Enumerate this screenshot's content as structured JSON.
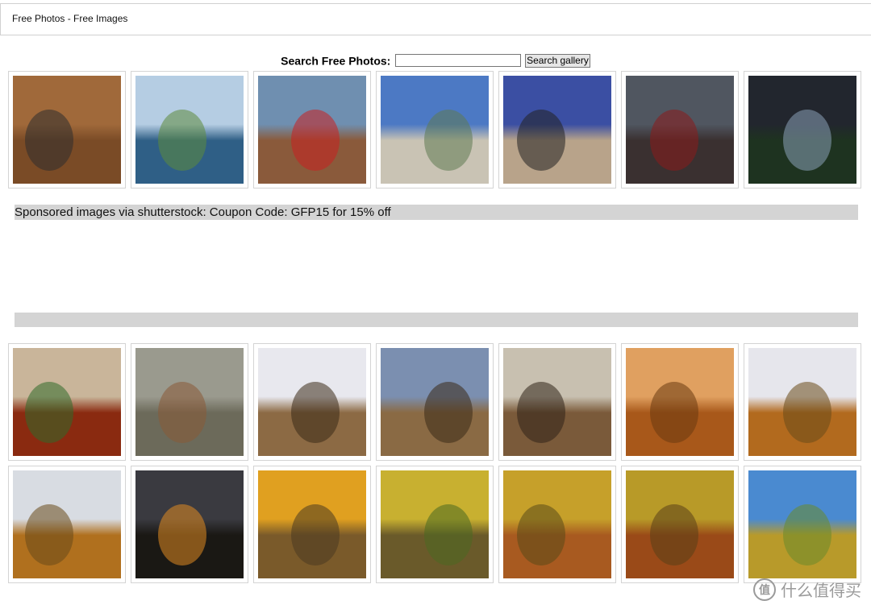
{
  "page": {
    "title": "Free Photos - Free Images"
  },
  "search": {
    "label": "Search Free Photos:",
    "input_value": "",
    "button_label": "Search gallery"
  },
  "sponsor": {
    "text": "Sponsored images via shutterstock: Coupon Code: GFP15 for 15% off"
  },
  "watermark": {
    "logo": "值",
    "text": "什么值得买"
  },
  "gallery": {
    "row1": [
      {
        "name": "photo-penny-farthing-bicycle",
        "sky": "#a0693a",
        "ground": "#7a4b26",
        "accent": "#2d2d2d"
      },
      {
        "name": "photo-lake-boat-fishing",
        "sky": "#b5cde3",
        "ground": "#2f5f86",
        "accent": "#5c8a3c"
      },
      {
        "name": "photo-street-drummer",
        "sky": "#6f8fb0",
        "ground": "#8a5a3b",
        "accent": "#c92020"
      },
      {
        "name": "photo-geyser-basin",
        "sky": "#4c79c4",
        "ground": "#c9c3b4",
        "accent": "#5e7a52"
      },
      {
        "name": "photo-man-badlands",
        "sky": "#3b4fa3",
        "ground": "#b8a38a",
        "accent": "#222"
      },
      {
        "name": "photo-stagecoach-museum",
        "sky": "#505660",
        "ground": "#3a3030",
        "accent": "#8a1c1c"
      },
      {
        "name": "photo-man-night-sky",
        "sky": "#22262e",
        "ground": "#1e3320",
        "accent": "#8aa0b8"
      }
    ],
    "row2": [
      {
        "name": "photo-spicy-stew",
        "sky": "#c9b59a",
        "ground": "#8a2a10",
        "accent": "#2f6a2a"
      },
      {
        "name": "photo-hawk-on-fence",
        "sky": "#9a9a8e",
        "ground": "#6c6a5a",
        "accent": "#8a5a36"
      },
      {
        "name": "photo-hawk-closeup-1",
        "sky": "#e8e8ee",
        "ground": "#8c6a44",
        "accent": "#3a2a18"
      },
      {
        "name": "photo-hawk-closeup-2",
        "sky": "#7b8fb0",
        "ground": "#8a6a44",
        "accent": "#3a2a18"
      },
      {
        "name": "photo-hawk-closeup-3",
        "sky": "#c8c0b0",
        "ground": "#7a5a3a",
        "accent": "#2f2218"
      },
      {
        "name": "photo-autumn-forest-sunset",
        "sky": "#e0a060",
        "ground": "#a8581a",
        "accent": "#6a3a10"
      },
      {
        "name": "photo-autumn-valley-1",
        "sky": "#e6e6ec",
        "ground": "#b26a1e",
        "accent": "#6a4a1a"
      }
    ],
    "row3": [
      {
        "name": "photo-autumn-valley-2",
        "sky": "#d8dce2",
        "ground": "#b0701e",
        "accent": "#6a4a1a"
      },
      {
        "name": "photo-dusk-horizon",
        "sky": "#3a3a40",
        "ground": "#1a1814",
        "accent": "#e08a20"
      },
      {
        "name": "photo-boardwalk-forest",
        "sky": "#e0a020",
        "ground": "#7a5a2a",
        "accent": "#4a3a20"
      },
      {
        "name": "photo-wooden-stairs-forest",
        "sky": "#c8b030",
        "ground": "#6a5a2a",
        "accent": "#4a6a20"
      },
      {
        "name": "photo-forest-path-1",
        "sky": "#c6a02a",
        "ground": "#a85a20",
        "accent": "#5a4a18"
      },
      {
        "name": "photo-forest-path-2",
        "sky": "#b89a28",
        "ground": "#9a4a18",
        "accent": "#5a4018"
      },
      {
        "name": "photo-hilltop-autumn",
        "sky": "#4a8ad0",
        "ground": "#b89a2a",
        "accent": "#6a8a2a"
      }
    ]
  }
}
